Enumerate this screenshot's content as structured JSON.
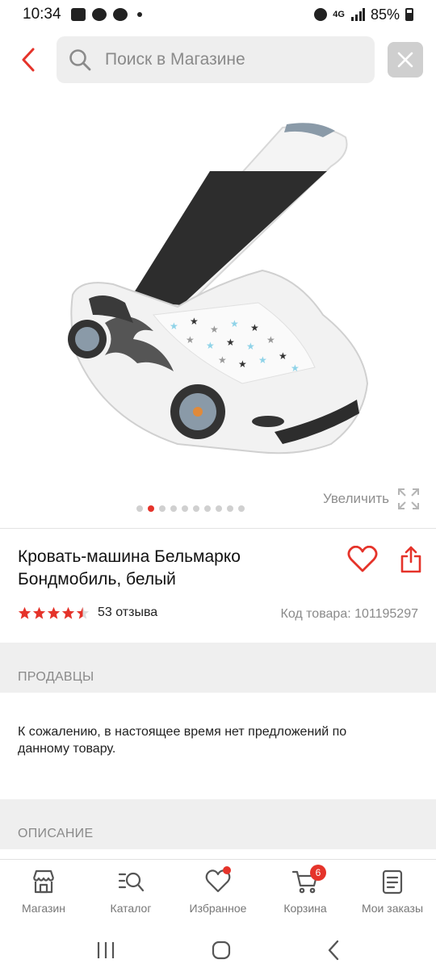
{
  "status_bar": {
    "time": "10:34",
    "network": "4G",
    "battery": "85%"
  },
  "search": {
    "placeholder": "Поиск в Магазине"
  },
  "gallery": {
    "zoom_label": "Увеличить",
    "dot_count": 10,
    "active_dot": 1
  },
  "product": {
    "title": "Кровать-машина Бельмарко Бондмобиль, белый",
    "rating": 4.5,
    "reviews": "53 отзыва",
    "sku": "Код товара: 101195297"
  },
  "sellers": {
    "label": "ПРОДАВЦЫ",
    "notice": "К сожалению, в настоящее время нет предложений по данному товару."
  },
  "description": {
    "label": "ОПИСАНИЕ"
  },
  "bottom_nav": {
    "shop": "Магазин",
    "catalog": "Каталог",
    "favorites": "Избранное",
    "cart": "Корзина",
    "cart_count": "6",
    "orders": "Мои заказы"
  },
  "colors": {
    "accent": "#e5332a",
    "muted": "#8a8a8a",
    "band": "#efefef"
  }
}
